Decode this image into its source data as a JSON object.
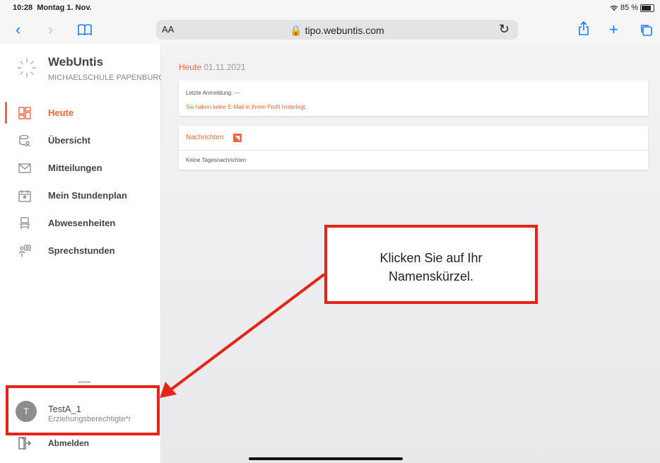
{
  "status_bar": {
    "time": "10:28",
    "date": "Montag 1. Nov.",
    "wifi_icon": "wifi-icon",
    "battery": "85 %"
  },
  "browser": {
    "text_size_label": "AA",
    "url": "tipo.webuntis.com"
  },
  "app": {
    "name": "WebUntis",
    "school": "MICHAELSCHULE PAPENBURG"
  },
  "sidebar": {
    "items": [
      {
        "label": "Heute",
        "icon": "dashboard-icon",
        "active": true
      },
      {
        "label": "Übersicht",
        "icon": "overview-icon",
        "active": false
      },
      {
        "label": "Mitteilungen",
        "icon": "mail-icon",
        "active": false
      },
      {
        "label": "Mein Stundenplan",
        "icon": "calendar-icon",
        "active": false
      },
      {
        "label": "Abwesenheiten",
        "icon": "chair-icon",
        "active": false
      },
      {
        "label": "Sprechstunden",
        "icon": "meeting-icon",
        "active": false
      }
    ],
    "user": {
      "initial": "T",
      "name": "TestA_1",
      "role": "Erziehungsberechtigte*r"
    },
    "logout_label": "Abmelden"
  },
  "main": {
    "heading": "Heute",
    "date": "01.11.2021",
    "last_login": "Letzte Anmeldung: ---",
    "email_warning": "Sie haben keine E-Mail in ihrem Profil hinterlegt.",
    "news_title": "Nachrichten",
    "news_empty": "Keine Tagesnachrichten"
  },
  "annotation": {
    "text": "Klicken Sie auf Ihr\nNamenskürzel.",
    "color": "#e42416"
  },
  "colors": {
    "accent": "#e8693b",
    "link": "#1a7cf5"
  }
}
